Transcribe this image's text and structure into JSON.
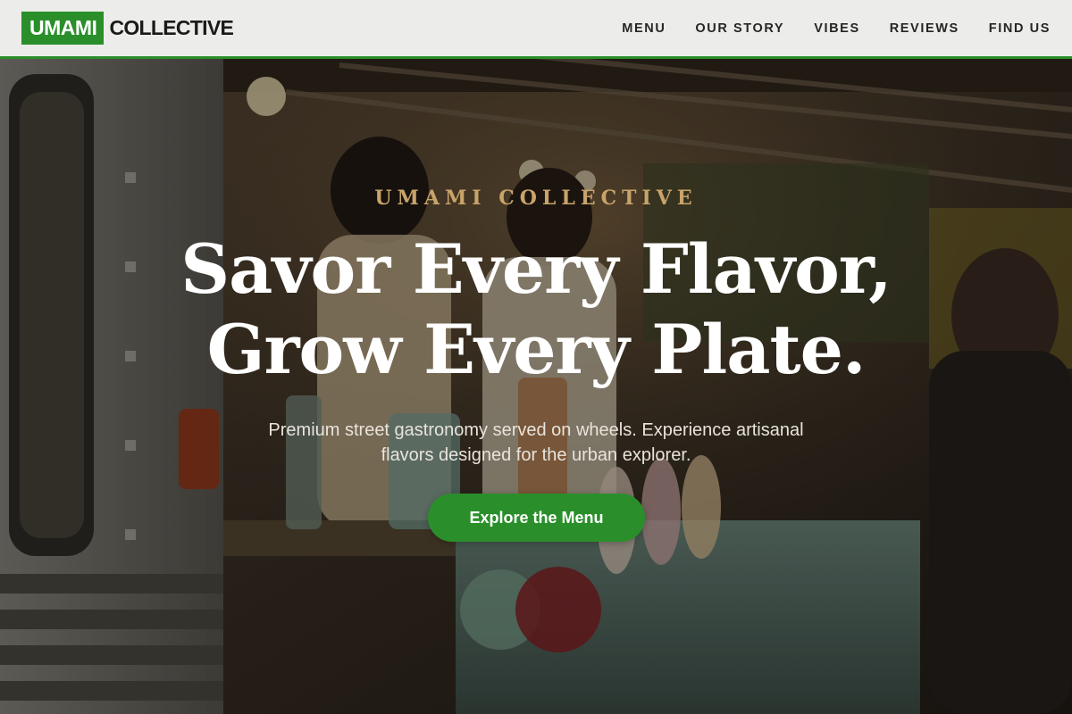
{
  "header": {
    "logo": {
      "highlight": "UMAMI",
      "text": "COLLECTIVE"
    },
    "nav": [
      {
        "label": "MENU"
      },
      {
        "label": "OUR STORY"
      },
      {
        "label": "VIBES"
      },
      {
        "label": "REVIEWS"
      },
      {
        "label": "FIND US"
      }
    ]
  },
  "hero": {
    "eyebrow": "UMAMI COLLECTIVE",
    "headline": [
      "Savor Every Flavor,",
      "Grow Every Plate."
    ],
    "subtitle": "Premium street gastronomy served on wheels. Experience artisanal flavors designed for the urban explorer.",
    "cta_label": "Explore the Menu"
  },
  "colors": {
    "brand_green": "#2a8f2a",
    "eyebrow_gold": "#c8a46a",
    "header_bg": "#ececea"
  }
}
